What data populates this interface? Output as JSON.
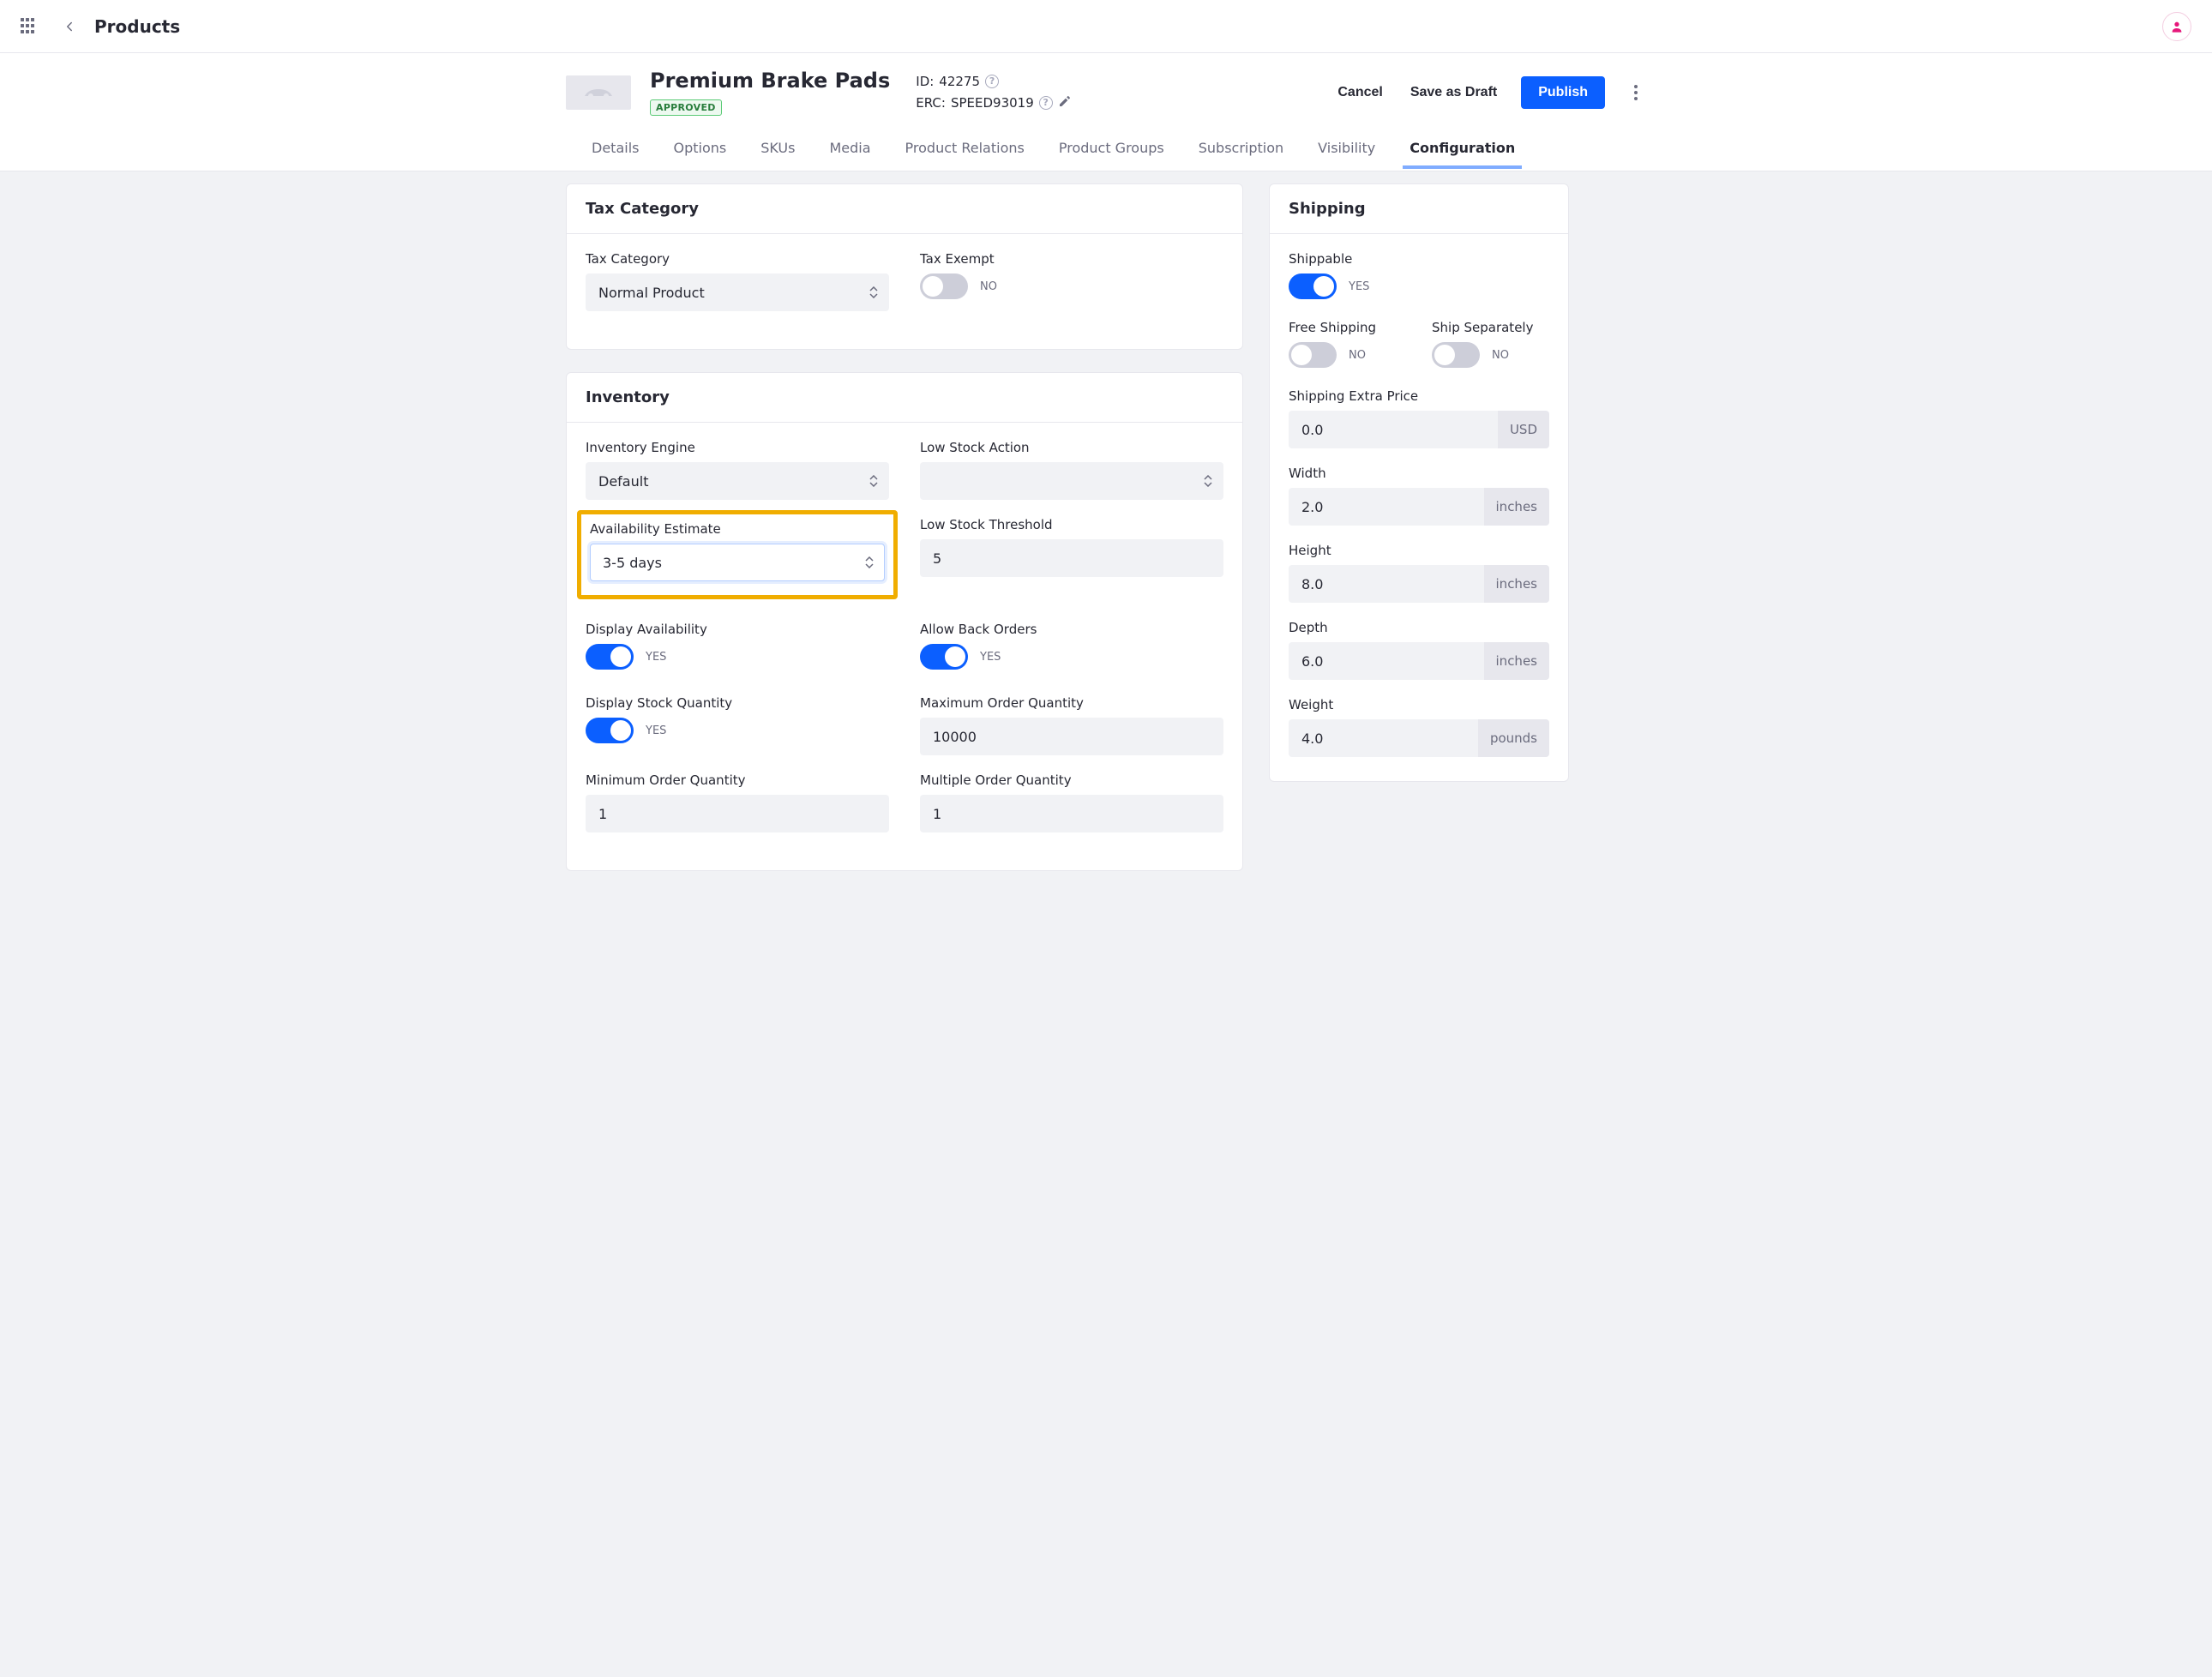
{
  "breadcrumb": "Products",
  "product": {
    "title": "Premium Brake Pads",
    "status": "APPROVED",
    "idLabel": "ID:",
    "idValue": "42275",
    "ercLabel": "ERC:",
    "ercValue": "SPEED93019"
  },
  "actions": {
    "cancel": "Cancel",
    "draft": "Save as Draft",
    "publish": "Publish"
  },
  "tabs": [
    {
      "key": "details",
      "label": "Details"
    },
    {
      "key": "options",
      "label": "Options"
    },
    {
      "key": "skus",
      "label": "SKUs"
    },
    {
      "key": "media",
      "label": "Media"
    },
    {
      "key": "relations",
      "label": "Product Relations"
    },
    {
      "key": "groups",
      "label": "Product Groups"
    },
    {
      "key": "subscription",
      "label": "Subscription"
    },
    {
      "key": "visibility",
      "label": "Visibility"
    },
    {
      "key": "configuration",
      "label": "Configuration",
      "active": true
    }
  ],
  "tax": {
    "title": "Tax Category",
    "categoryLabel": "Tax Category",
    "categoryValue": "Normal Product",
    "exemptLabel": "Tax Exempt",
    "exemptOn": false,
    "no": "NO"
  },
  "inventory": {
    "title": "Inventory",
    "engineLabel": "Inventory Engine",
    "engineValue": "Default",
    "lowStockActionLabel": "Low Stock Action",
    "lowStockActionValue": "",
    "availEstimateLabel": "Availability Estimate",
    "availEstimateValue": "3-5 days",
    "lowStockThresholdLabel": "Low Stock Threshold",
    "lowStockThresholdValue": "5",
    "displayAvailLabel": "Display Availability",
    "displayAvailOn": true,
    "allowBackLabel": "Allow Back Orders",
    "allowBackOn": true,
    "displayStockLabel": "Display Stock Quantity",
    "displayStockOn": true,
    "maxOrderLabel": "Maximum Order Quantity",
    "maxOrderValue": "10000",
    "minOrderLabel": "Minimum Order Quantity",
    "minOrderValue": "1",
    "multOrderLabel": "Multiple Order Quantity",
    "multOrderValue": "1",
    "yes": "YES"
  },
  "shipping": {
    "title": "Shipping",
    "shippableLabel": "Shippable",
    "shippableOn": true,
    "yes": "YES",
    "no": "NO",
    "freeLabel": "Free Shipping",
    "freeOn": false,
    "separatelyLabel": "Ship Separately",
    "separatelyOn": false,
    "extraPriceLabel": "Shipping Extra Price",
    "extraPriceValue": "0.0",
    "extraPriceUnit": "USD",
    "widthLabel": "Width",
    "widthValue": "2.0",
    "widthUnit": "inches",
    "heightLabel": "Height",
    "heightValue": "8.0",
    "heightUnit": "inches",
    "depthLabel": "Depth",
    "depthValue": "6.0",
    "depthUnit": "inches",
    "weightLabel": "Weight",
    "weightValue": "4.0",
    "weightUnit": "pounds"
  }
}
